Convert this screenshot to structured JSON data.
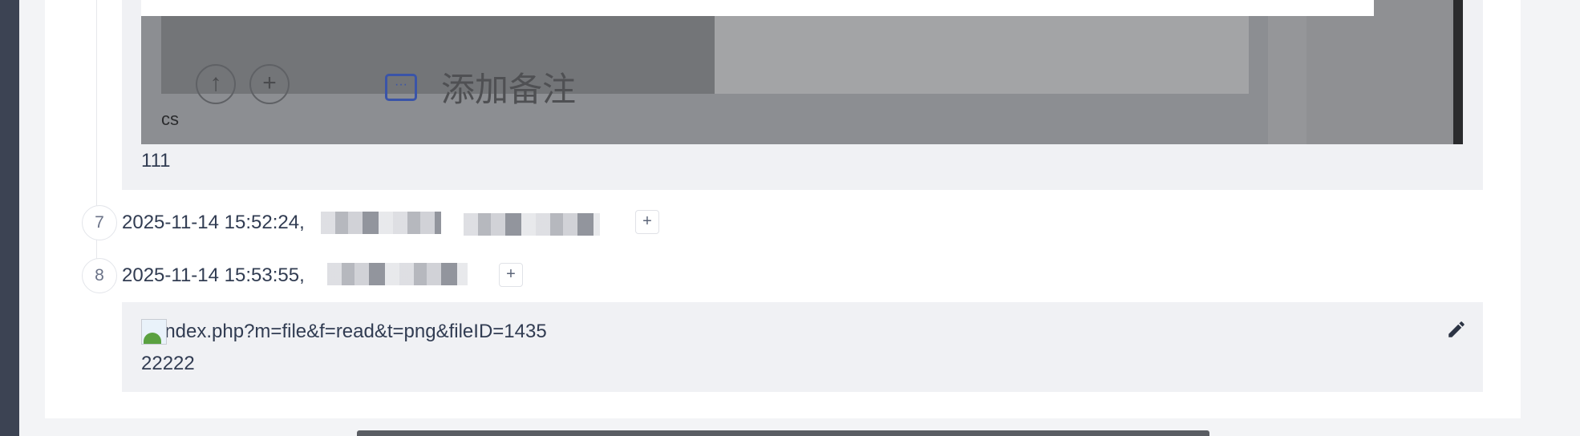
{
  "attached_screenshot": {
    "note_button_label": "添加备注",
    "up_button_glyph": "↑",
    "plus_button_glyph": "+",
    "caption": "cs"
  },
  "comment_1": {
    "text": "111"
  },
  "history": [
    {
      "index": "7",
      "timestamp": "2025-11-14 15:52:24,",
      "expand_glyph": "+"
    },
    {
      "index": "8",
      "timestamp": "2025-11-14 15:53:55,",
      "expand_glyph": "+"
    }
  ],
  "comment_2": {
    "image_alt": "index.php?m=file&f=read&t=png&fileID=1435",
    "text": "22222"
  },
  "icons": {
    "edit": "pencil-icon",
    "broken_image": "broken-image-icon",
    "note": "note-icon"
  },
  "colors": {
    "panel_background": "#ffffff",
    "comment_background": "#f0f1f4",
    "text": "#313c52",
    "note_icon": "#3a54a8"
  }
}
